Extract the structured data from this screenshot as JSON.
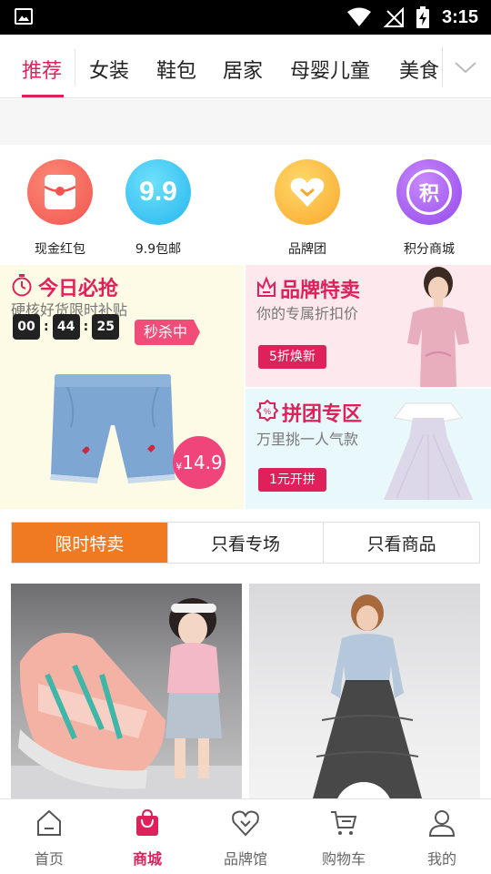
{
  "status_bar": {
    "time": "3:15"
  },
  "category_tabs": [
    {
      "label": "推荐",
      "active": true
    },
    {
      "label": "女装"
    },
    {
      "label": "鞋包"
    },
    {
      "label": "居家"
    },
    {
      "label": "母婴儿童"
    },
    {
      "label": "美食"
    }
  ],
  "quick_entries": [
    {
      "label": "现金红包",
      "icon": "red-packet-icon",
      "color": "#f4615b"
    },
    {
      "label": "9.9包邮",
      "icon": "nine-nine-icon",
      "glyph": "9.9",
      "color": "#3cc8f0"
    },
    {
      "label": "品牌团",
      "icon": "brand-heart-icon",
      "color": "#fbb83c"
    },
    {
      "label": "积分商城",
      "icon": "points-icon",
      "glyph": "积",
      "color": "#a45cf0"
    }
  ],
  "flash_sale": {
    "title": "今日必抢",
    "subtitle": "硬核好货限时补贴",
    "timer": [
      "00",
      "44",
      "25"
    ],
    "badge": "秒杀中",
    "price_symbol": "¥",
    "price": "14.9"
  },
  "brand_sale": {
    "title": "品牌特卖",
    "subtitle": "你的专属折扣价",
    "pill": "5折焕新"
  },
  "group_buy": {
    "title": "拼团专区",
    "subtitle": "万里挑一人气款",
    "pill": "1元开拼"
  },
  "filter_tabs": [
    {
      "label": "限时特卖",
      "active": true
    },
    {
      "label": "只看专场"
    },
    {
      "label": "只看商品"
    }
  ],
  "bottom_nav": [
    {
      "label": "首页",
      "icon": "home-icon"
    },
    {
      "label": "商城",
      "icon": "shop-bag-icon",
      "active": true
    },
    {
      "label": "品牌馆",
      "icon": "brand-icon"
    },
    {
      "label": "购物车",
      "icon": "cart-icon"
    },
    {
      "label": "我的",
      "icon": "profile-icon"
    }
  ],
  "colors": {
    "accent": "#e0205a",
    "orange": "#f07a22"
  }
}
